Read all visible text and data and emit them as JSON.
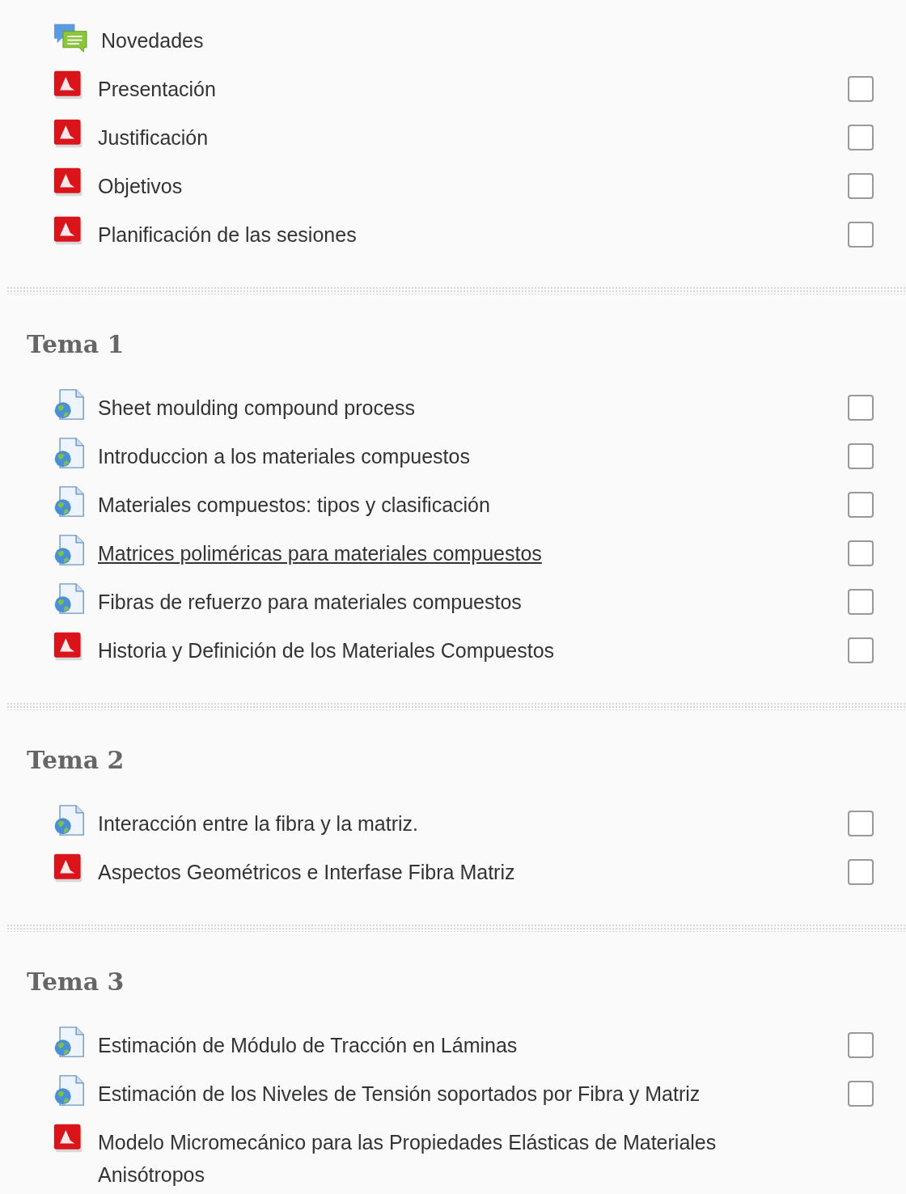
{
  "sections": [
    {
      "items": [
        {
          "kind": "forum",
          "label": "Novedades",
          "hovered": false
        },
        {
          "kind": "pdf",
          "label": "Presentación",
          "hovered": false,
          "checked": false
        },
        {
          "kind": "pdf",
          "label": "Justificación",
          "hovered": false,
          "checked": false
        },
        {
          "kind": "pdf",
          "label": "Objetivos",
          "hovered": false,
          "checked": false
        },
        {
          "kind": "pdf",
          "label": "Planificación de las sesiones",
          "hovered": false,
          "checked": false
        }
      ]
    },
    {
      "title": "Tema 1",
      "items": [
        {
          "kind": "url",
          "label": "Sheet moulding compound process",
          "hovered": false,
          "checked": false
        },
        {
          "kind": "url",
          "label": "Introduccion a los materiales compuestos",
          "hovered": false,
          "checked": false
        },
        {
          "kind": "url",
          "label": "Materiales compuestos: tipos y clasificación",
          "hovered": false,
          "checked": false
        },
        {
          "kind": "url",
          "label": "Matrices poliméricas para materiales compuestos",
          "hovered": true,
          "checked": false
        },
        {
          "kind": "url",
          "label": "Fibras de refuerzo para materiales compuestos",
          "hovered": false,
          "checked": false
        },
        {
          "kind": "pdf",
          "label": "Historia y Definición de los Materiales Compuestos",
          "hovered": false,
          "checked": false
        }
      ]
    },
    {
      "title": "Tema 2",
      "items": [
        {
          "kind": "url",
          "label": "Interacción entre la fibra y la matriz.",
          "hovered": false,
          "checked": false
        },
        {
          "kind": "pdf",
          "label": "Aspectos Geométricos e Interfase Fibra Matriz",
          "hovered": false,
          "checked": false
        }
      ]
    },
    {
      "title": "Tema 3",
      "items": [
        {
          "kind": "url",
          "label": "Estimación de Módulo de Tracción en Láminas",
          "hovered": false,
          "checked": false
        },
        {
          "kind": "url",
          "label": "Estimación de los Niveles de Tensión soportados por Fibra y Matriz",
          "hovered": false,
          "checked": false
        },
        {
          "kind": "pdf",
          "label": "Modelo Micromecánico para las Propiedades Elásticas de Materiales Anisótropos",
          "hovered": false
        }
      ]
    }
  ]
}
